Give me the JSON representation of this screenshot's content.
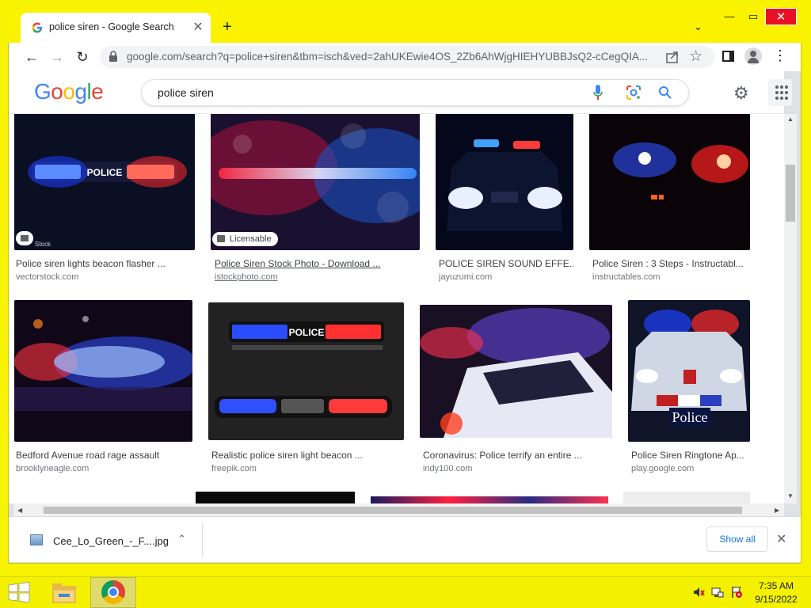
{
  "browser": {
    "tab_title": "police siren - Google Search",
    "tab_favicon": "google-favicon",
    "new_tab_label": "+",
    "url": "google.com/search?q=police+siren&tbm=isch&ved=2ahUKEwie4OS_2Zb6AhWjgHIEHYUBBJsQ2-cCegQIA..."
  },
  "google": {
    "logo_letters": [
      "G",
      "o",
      "o",
      "g",
      "l",
      "e"
    ],
    "search_value": "police siren"
  },
  "results": [
    {
      "title": "Police siren lights beacon flasher ...",
      "source": "vectorstock.com",
      "badge": "",
      "thumb_colors": [
        "#0b0f24",
        "#1e3cff",
        "#ff2a2a"
      ]
    },
    {
      "title": "Police Siren Stock Photo - Download ...",
      "source": "istockphoto.com",
      "badge": "Licensable",
      "thumb_colors": [
        "#1a1030",
        "#ff4060",
        "#40a0ff"
      ]
    },
    {
      "title": "POLICE SIREN SOUND EFFE...",
      "source": "jayuzumi.com",
      "badge": "",
      "thumb_colors": [
        "#05081a",
        "#2a60ff",
        "#e8f0ff"
      ]
    },
    {
      "title": "Police Siren : 3 Steps - Instructabl...",
      "source": "instructables.com",
      "badge": "",
      "thumb_colors": [
        "#0a0408",
        "#ff2020",
        "#3050ff"
      ]
    },
    {
      "title": "Bedford Avenue road rage assault",
      "source": "brooklyneagle.com",
      "badge": "",
      "thumb_colors": [
        "#100818",
        "#3050ff",
        "#ff3040"
      ]
    },
    {
      "title": "Realistic police siren light beacon ...",
      "source": "freepik.com",
      "badge": "",
      "thumb_colors": [
        "#222222",
        "#2a4cff",
        "#ff3030"
      ]
    },
    {
      "title": "Coronavirus: Police terrify an entire ...",
      "source": "indy100.com",
      "badge": "",
      "thumb_colors": [
        "#1a1024",
        "#7050ff",
        "#ff3050"
      ]
    },
    {
      "title": "Police Siren Ringtone Ap...",
      "source": "play.google.com",
      "badge": "",
      "thumb_colors": [
        "#101428",
        "#2040ff",
        "#ff2a2a"
      ]
    }
  ],
  "thumb_text": {
    "police_bar": "POLICE",
    "freepik_bar": "POLICE",
    "ringtone_plate": "Police",
    "vector_watermark": "Stock"
  },
  "downloads": {
    "file_name": "Cee_Lo_Green_-_F....jpg",
    "show_all_label": "Show all"
  },
  "taskbar": {
    "time": "7:35 AM",
    "date": "9/15/2022"
  },
  "icons": {
    "back": "←",
    "forward": "→",
    "reload": "↻",
    "star": "☆",
    "menu": "⋮",
    "settings": "⚙",
    "close": "✕",
    "chevron_up": "⌃",
    "chevron_down": "⌄",
    "minimize": "—",
    "maximize": "▭"
  }
}
